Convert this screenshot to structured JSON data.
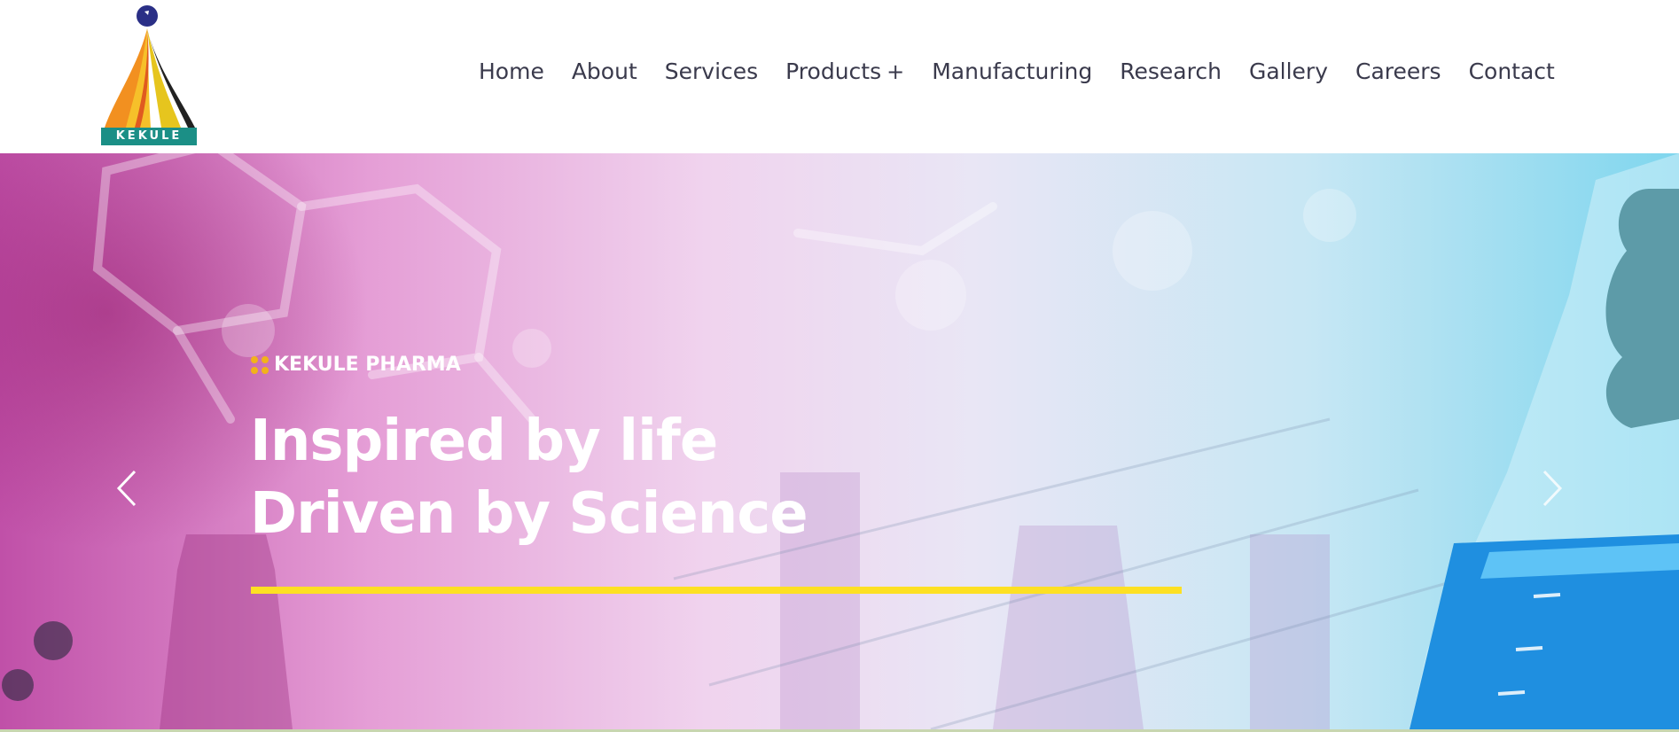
{
  "logo": {
    "text": "KEKULE"
  },
  "nav": {
    "items": [
      {
        "label": "Home"
      },
      {
        "label": "About"
      },
      {
        "label": "Services"
      },
      {
        "label": "Products"
      },
      {
        "label": "Manufacturing"
      },
      {
        "label": "Research"
      },
      {
        "label": "Gallery"
      },
      {
        "label": "Careers"
      },
      {
        "label": "Contact"
      }
    ],
    "products_expand_icon": "plus-icon"
  },
  "hero": {
    "eyebrow": "KEKULE PHARMA",
    "headline_line1": "Inspired by life",
    "headline_line2": "Driven by Science",
    "slide_progress": 1.0,
    "prev_icon": "chevron-left-icon",
    "next_icon": "chevron-right-icon"
  },
  "colors": {
    "accent_yellow": "#fde023",
    "dots_orange": "#f2b21b",
    "nav_text": "#3a3a4c"
  }
}
